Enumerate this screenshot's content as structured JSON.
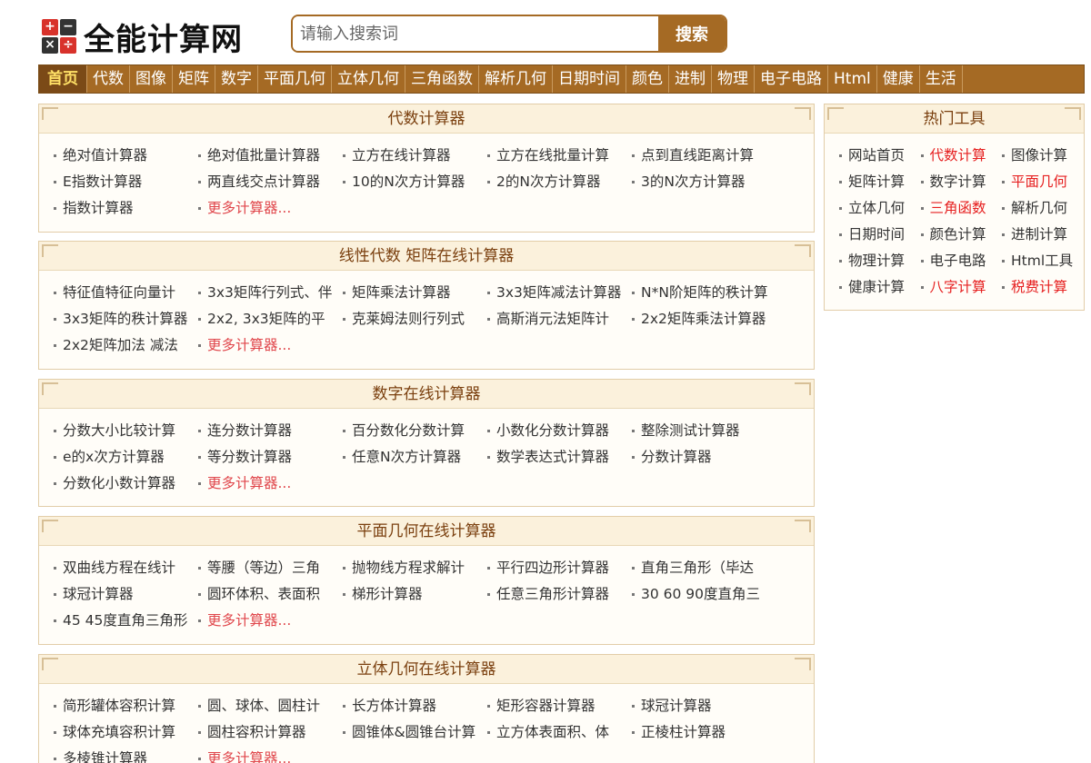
{
  "logo": {
    "text": "全能计算网",
    "icon_cells": [
      "+",
      "−",
      "×",
      "÷"
    ]
  },
  "search": {
    "placeholder": "请输入搜索词",
    "button": "搜索"
  },
  "nav": [
    "首页",
    "代数",
    "图像",
    "矩阵",
    "数字",
    "平面几何",
    "立体几何",
    "三角函数",
    "解析几何",
    "日期时间",
    "颜色",
    "进制",
    "物理",
    "电子电路",
    "Html",
    "健康",
    "生活"
  ],
  "sections": [
    {
      "title": "代数计算器",
      "items": [
        "绝对值计算器",
        "绝对值批量计算器",
        "立方在线计算器",
        "立方在线批量计算",
        "点到直线距离计算",
        "E指数计算器",
        "两直线交点计算器",
        "10的N次方计算器",
        "2的N次方计算器",
        "3的N次方计算器",
        "指数计算器"
      ],
      "more": "更多计算器..."
    },
    {
      "title": "线性代数 矩阵在线计算器",
      "items": [
        "特征值特征向量计",
        "3x3矩阵行列式、伴",
        "矩阵乘法计算器",
        "3x3矩阵减法计算器",
        "N*N阶矩阵的秩计算",
        "3x3矩阵的秩计算器",
        "2x2, 3x3矩阵的平",
        "克莱姆法则行列式",
        "高斯消元法矩阵计",
        "2x2矩阵乘法计算器",
        "2x2矩阵加法 减法"
      ],
      "more": "更多计算器..."
    },
    {
      "title": "数字在线计算器",
      "items": [
        "分数大小比较计算",
        "连分数计算器",
        "百分数化分数计算",
        "小数化分数计算器",
        "整除测试计算器",
        "e的x次方计算器",
        "等分数计算器",
        "任意N次方计算器",
        "数学表达式计算器",
        "分数计算器",
        "分数化小数计算器"
      ],
      "more": "更多计算器..."
    },
    {
      "title": "平面几何在线计算器",
      "items": [
        "双曲线方程在线计",
        "等腰（等边）三角",
        "抛物线方程求解计",
        "平行四边形计算器",
        "直角三角形（毕达",
        "球冠计算器",
        "圆环体积、表面积",
        "梯形计算器",
        "任意三角形计算器",
        "30 60 90度直角三",
        "45 45度直角三角形"
      ],
      "more": "更多计算器..."
    },
    {
      "title": "立体几何在线计算器",
      "items": [
        "简形罐体容积计算",
        "圆、球体、圆柱计",
        "长方体计算器",
        "矩形容器计算器",
        "球冠计算器",
        "球体充填容积计算",
        "圆柱容积计算器",
        "圆锥体&圆锥台计算",
        "立方体表面积、体",
        "正棱柱计算器",
        "多棱锥计算器"
      ],
      "more": "更多计算器..."
    }
  ],
  "hot": {
    "title": "热门工具",
    "items": [
      {
        "label": "网站首页",
        "highlight": false
      },
      {
        "label": "代数计算",
        "highlight": true
      },
      {
        "label": "图像计算",
        "highlight": false
      },
      {
        "label": "矩阵计算",
        "highlight": false
      },
      {
        "label": "数字计算",
        "highlight": false
      },
      {
        "label": "平面几何",
        "highlight": true
      },
      {
        "label": "立体几何",
        "highlight": false
      },
      {
        "label": "三角函数",
        "highlight": true
      },
      {
        "label": "解析几何",
        "highlight": false
      },
      {
        "label": "日期时间",
        "highlight": false
      },
      {
        "label": "颜色计算",
        "highlight": false
      },
      {
        "label": "进制计算",
        "highlight": false
      },
      {
        "label": "物理计算",
        "highlight": false
      },
      {
        "label": "电子电路",
        "highlight": false
      },
      {
        "label": "Html工具",
        "highlight": false
      },
      {
        "label": "健康计算",
        "highlight": false
      },
      {
        "label": "八字计算",
        "highlight": true
      },
      {
        "label": "税费计算",
        "highlight": true
      }
    ]
  },
  "colors": {
    "brand": "#a56a24",
    "nav_active": "#7b4a17",
    "more_link": "#e0464b",
    "highlight": "#e62020"
  }
}
